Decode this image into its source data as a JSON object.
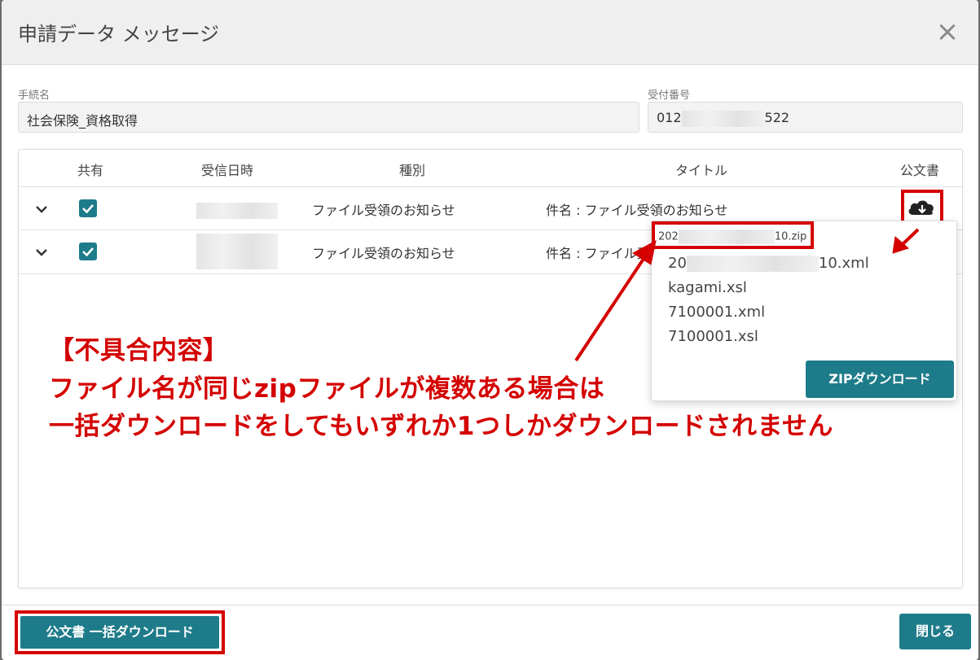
{
  "dialog": {
    "title": "申請データ メッセージ",
    "close_icon": "close-icon"
  },
  "fields": {
    "procedure_label": "手続名",
    "procedure_value": "社会保険_資格取得",
    "receipt_label": "受付番号",
    "receipt_prefix": "012",
    "receipt_suffix": "522"
  },
  "table": {
    "headers": [
      "共有",
      "受信日時",
      "種別",
      "タイトル",
      "公文書"
    ],
    "rows": [
      {
        "type": "ファイル受領のお知らせ",
        "title": "件名 : ファイル受領のお知らせ",
        "shared": true
      },
      {
        "type": "ファイル受領のお知らせ",
        "title": "件名 : ファイル受",
        "shared": true
      }
    ]
  },
  "popup": {
    "zip_prefix": "202",
    "zip_suffix": "10.zip",
    "files": [
      {
        "prefix": "20",
        "suffix": "10.xml"
      },
      {
        "prefix": "kagami.xsl",
        "suffix": ""
      },
      {
        "prefix": "7100001.xml",
        "suffix": ""
      },
      {
        "prefix": "7100001.xsl",
        "suffix": ""
      }
    ],
    "zip_button": "ZIPダウンロード"
  },
  "annotation": {
    "line1": "【不具合内容】",
    "line2": "ファイル名が同じzipファイルが複数ある場合は",
    "line3": "一括ダウンロードをしてもいずれか1つしかダウンロードされません"
  },
  "footer": {
    "bulk_download": "公文書 一括ダウンロード",
    "close": "閉じる"
  },
  "colors": {
    "accent": "#1e7b8a",
    "annotation_red": "#d40000"
  }
}
